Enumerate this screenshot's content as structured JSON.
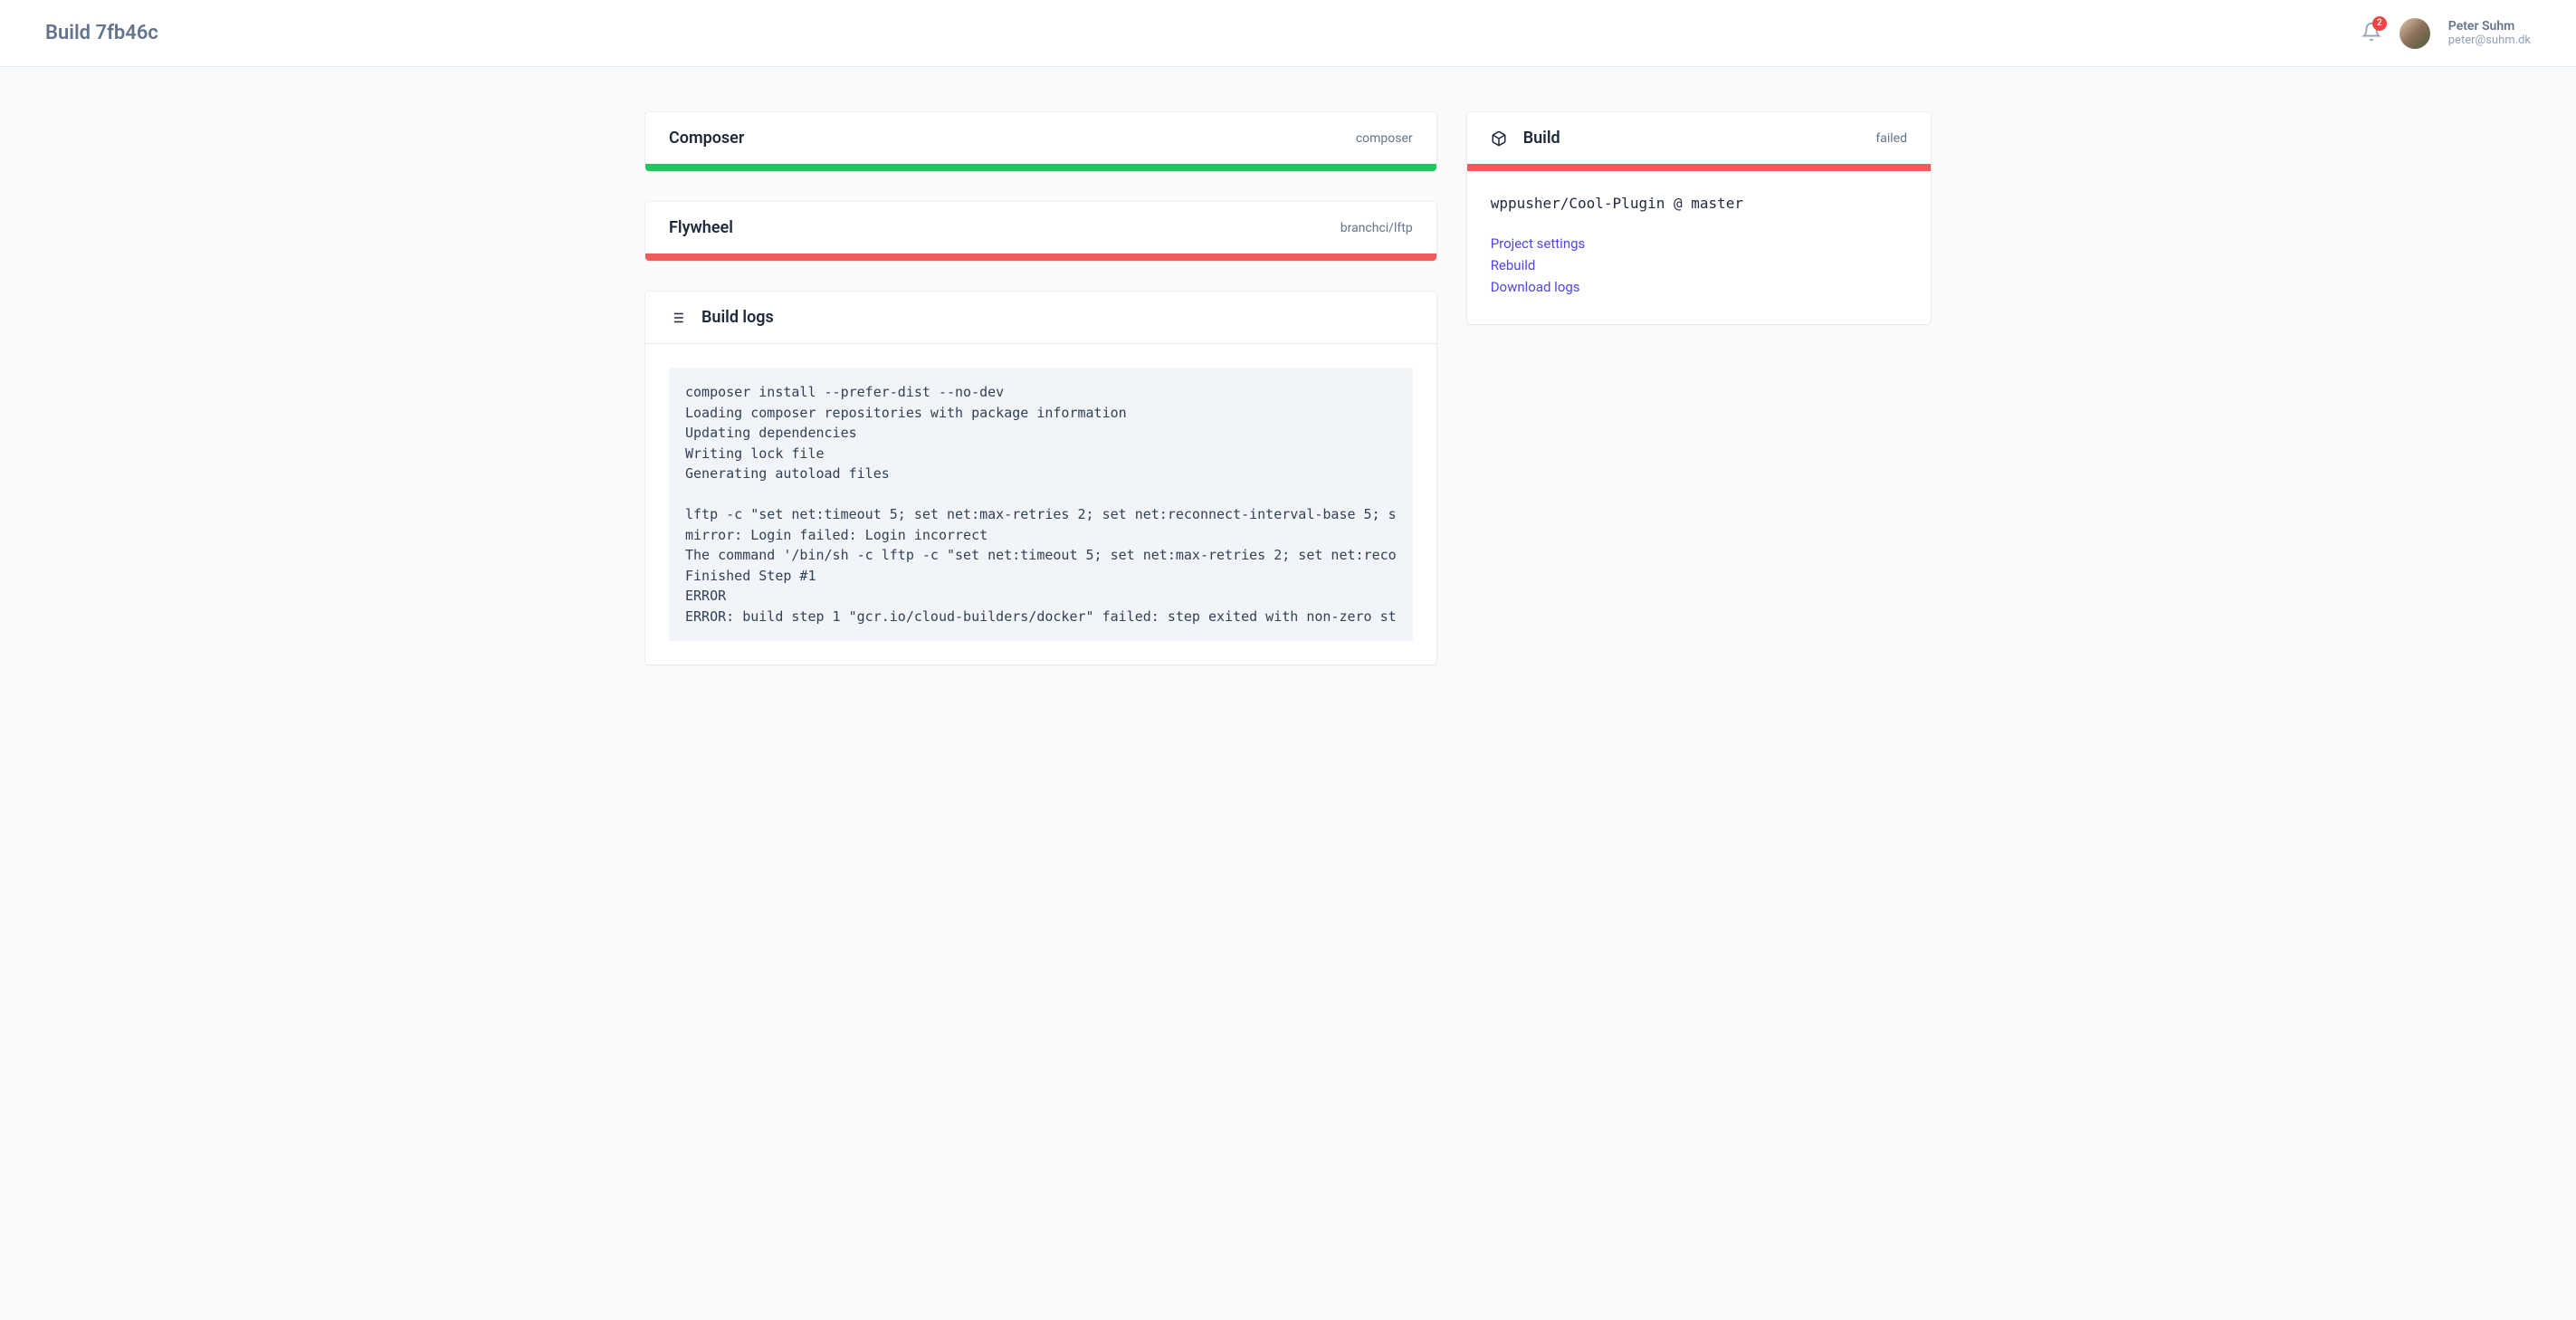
{
  "header": {
    "title": "Build 7fb46c",
    "notifications_count": "2",
    "user_name": "Peter Suhm",
    "user_email": "peter@suhm.dk"
  },
  "steps": [
    {
      "title": "Composer",
      "slug": "composer",
      "status": "success"
    },
    {
      "title": "Flywheel",
      "slug": "branchci/lftp",
      "status": "failed"
    }
  ],
  "logs": {
    "title": "Build logs",
    "content": "composer install --prefer-dist --no-dev\nLoading composer repositories with package information\nUpdating dependencies\nWriting lock file\nGenerating autoload files\n\nlftp -c \"set net:timeout 5; set net:max-retries 2; set net:reconnect-interval-base 5; s\nmirror: Login failed: Login incorrect\nThe command '/bin/sh -c lftp -c \"set net:timeout 5; set net:max-retries 2; set net:reco\nFinished Step #1\nERROR\nERROR: build step 1 \"gcr.io/cloud-builders/docker\" failed: step exited with non-zero st"
  },
  "sidebar": {
    "title": "Build",
    "status": "failed",
    "repo_ref": "wppusher/Cool-Plugin @ master",
    "links": {
      "project_settings": "Project settings",
      "rebuild": "Rebuild",
      "download_logs": "Download logs"
    }
  }
}
